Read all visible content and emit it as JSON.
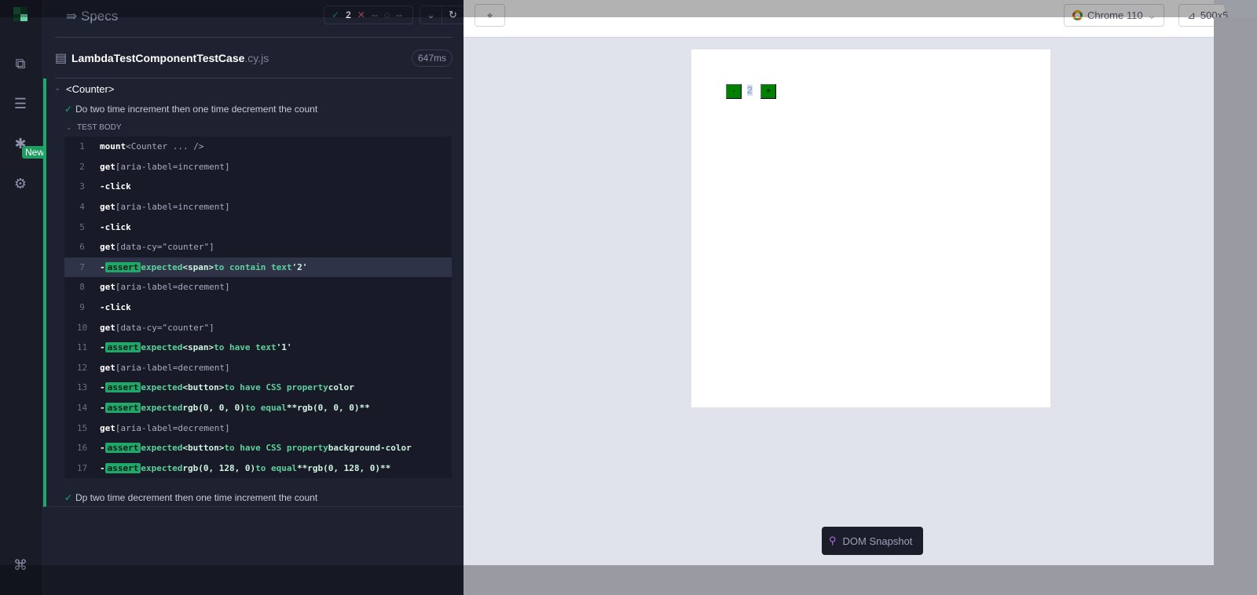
{
  "nav": {
    "new_badge": "New"
  },
  "header": {
    "title": "Specs",
    "passed": "2",
    "failed": "--",
    "pending": "--"
  },
  "file": {
    "name": "LambdaTestComponentTestCase",
    "ext": ".cy.js",
    "duration": "647ms"
  },
  "suite": {
    "title": "<Counter>",
    "tests": [
      {
        "title": "Do two time increment then one time decrement the count",
        "section": "TEST BODY"
      },
      {
        "title": "Dp two time decrement then one time increment the count"
      }
    ]
  },
  "commands": [
    {
      "num": "1",
      "cmd": "mount",
      "arg": "<Counter ... />"
    },
    {
      "num": "2",
      "cmd": "get",
      "arg": "[aria-label=increment]"
    },
    {
      "num": "3",
      "cmd": "-click",
      "arg": ""
    },
    {
      "num": "4",
      "cmd": "get",
      "arg": "[aria-label=increment]"
    },
    {
      "num": "5",
      "cmd": "-click",
      "arg": ""
    },
    {
      "num": "6",
      "cmd": "get",
      "arg": "[data-cy=\"counter\"]"
    },
    {
      "num": "7",
      "assert": true,
      "selected": true,
      "parts": [
        [
          "expected",
          0
        ],
        [
          "<span>",
          1
        ],
        [
          "to contain text",
          0
        ],
        [
          "'2'",
          1
        ]
      ]
    },
    {
      "num": "8",
      "cmd": "get",
      "arg": "[aria-label=decrement]"
    },
    {
      "num": "9",
      "cmd": "-click",
      "arg": ""
    },
    {
      "num": "10",
      "cmd": "get",
      "arg": "[data-cy=\"counter\"]"
    },
    {
      "num": "11",
      "assert": true,
      "parts": [
        [
          "expected",
          0
        ],
        [
          "<span>",
          1
        ],
        [
          "to have text",
          0
        ],
        [
          "'1'",
          1
        ]
      ]
    },
    {
      "num": "12",
      "cmd": "get",
      "arg": "[aria-label=decrement]"
    },
    {
      "num": "13",
      "assert": true,
      "parts": [
        [
          "expected",
          0
        ],
        [
          "<button>",
          1
        ],
        [
          "to have CSS property",
          0
        ],
        [
          "color",
          1
        ]
      ]
    },
    {
      "num": "14",
      "assert": true,
      "parts": [
        [
          "expected",
          0
        ],
        [
          "rgb(0, 0, 0)",
          1
        ],
        [
          "to equal",
          0
        ],
        [
          "**rgb(0, 0, 0)**",
          1
        ]
      ]
    },
    {
      "num": "15",
      "cmd": "get",
      "arg": "[aria-label=decrement]"
    },
    {
      "num": "16",
      "assert": true,
      "parts": [
        [
          "expected",
          0
        ],
        [
          "<button>",
          1
        ],
        [
          "to have CSS property",
          0
        ],
        [
          "background-color",
          1
        ]
      ]
    },
    {
      "num": "17",
      "assert": true,
      "parts": [
        [
          "expected",
          0
        ],
        [
          "rgb(0, 128, 0)",
          1
        ],
        [
          "to equal",
          0
        ],
        [
          "**rgb(0, 128, 0)**",
          1
        ]
      ]
    }
  ],
  "assert_label": "assert",
  "aut": {
    "browser": "Chrome 110",
    "viewport": "500x5",
    "counter": {
      "minus": "-",
      "value": "2",
      "plus": "+"
    },
    "snapshot": "DOM Snapshot"
  },
  "colors": {
    "accent": "#1fa869",
    "nav": "#191b27",
    "reporter": "#1e2130"
  }
}
